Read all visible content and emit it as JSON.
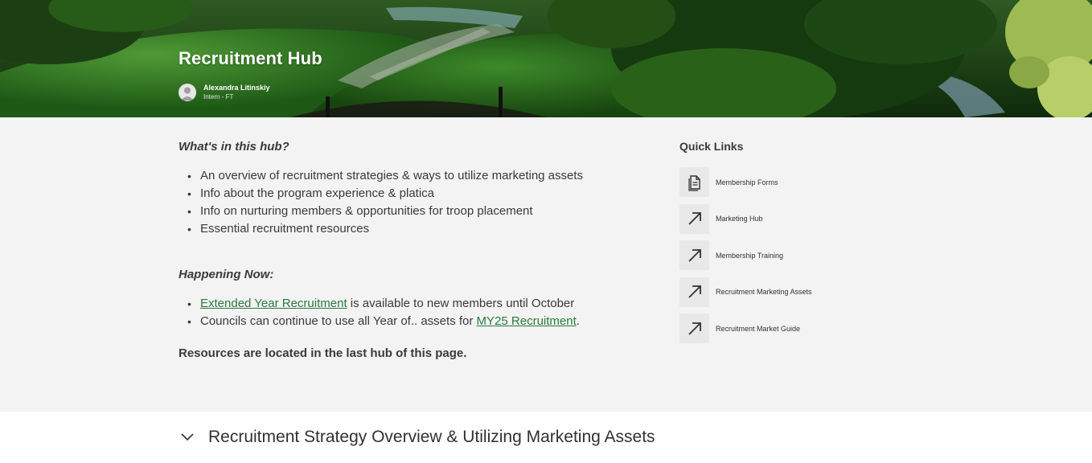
{
  "hero": {
    "title": "Recruitment Hub",
    "author_name": "Alexandra Litinskiy",
    "author_role": "Intern - FT"
  },
  "intro": {
    "heading": "What's in this hub?",
    "bullets": [
      "An overview of recruitment strategies & ways to utilize marketing assets",
      "Info about the program experience & platica",
      "Info on nurturing members & opportunities for troop placement",
      "Essential recruitment resources"
    ]
  },
  "happening": {
    "heading": "Happening Now:",
    "item1_link": "Extended Year Recruitment",
    "item1_rest": " is available to new members until October",
    "item2_text": "Councils can continue to use all Year of.. assets for ",
    "item2_link": "MY25 Recruitment",
    "item2_end": "."
  },
  "resources_note": "Resources are located in the last hub of this page.",
  "quick_links": {
    "title": "Quick Links",
    "items": [
      {
        "label": "Membership Forms",
        "icon": "document-icon"
      },
      {
        "label": "Marketing Hub",
        "icon": "arrow-up-right-icon"
      },
      {
        "label": "Membership Training",
        "icon": "arrow-up-right-icon"
      },
      {
        "label": "Recruitment Marketing Assets",
        "icon": "arrow-up-right-icon"
      },
      {
        "label": "Recruitment Market Guide",
        "icon": "arrow-up-right-icon"
      }
    ]
  },
  "section": {
    "title": "Recruitment Strategy Overview & Utilizing Marketing Assets"
  },
  "colors": {
    "link": "#2a7a3d",
    "content_bg": "#f3f3f3",
    "text": "#3b3a39"
  }
}
